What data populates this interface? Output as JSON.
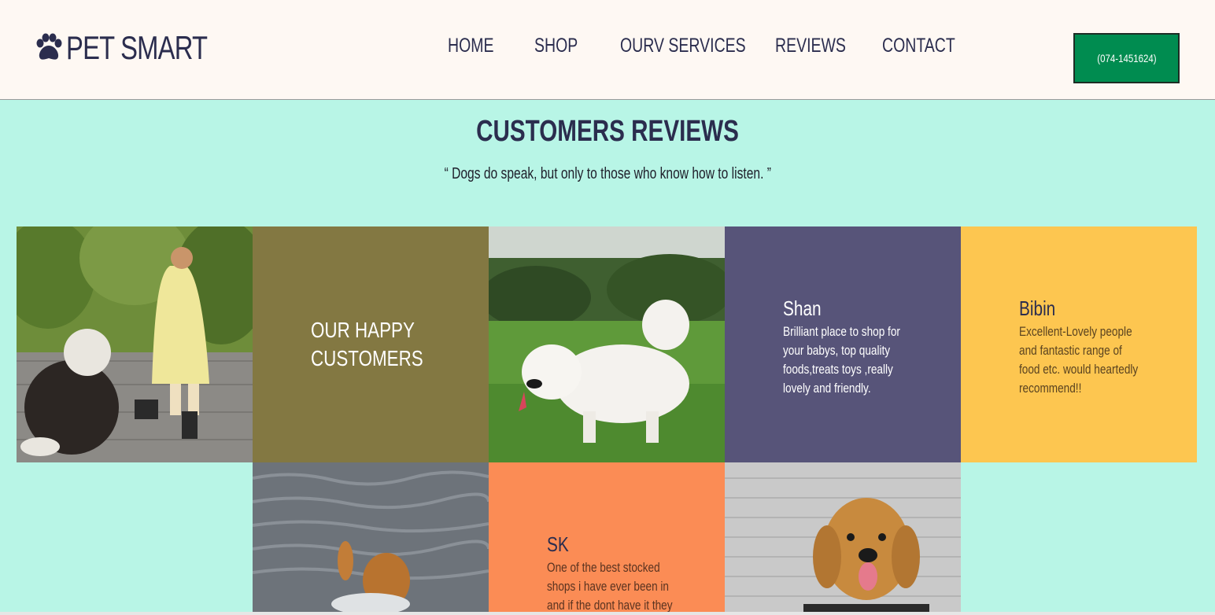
{
  "header": {
    "logo_text": "PET SMART",
    "logo_icon": "paw-icon",
    "nav": {
      "home": "HOME",
      "shop": "SHOP",
      "services": "OURV SERVICES",
      "reviews": "REVIEWS",
      "contact": "CONTACT"
    },
    "phone": "(074-1451624)"
  },
  "reviews_section": {
    "title": "CUSTOMERS REVIEWS",
    "quote": "“ Dogs do speak, but only to those who know how to listen. ”",
    "happy_heading": "OUR HAPPY CUSTOMERS",
    "reviews": [
      {
        "name": "Shan",
        "text": "Brilliant place to shop for your babys, top quality foods,treats toys ,really lovely and friendly."
      },
      {
        "name": "Bibin",
        "text": "Excellent-Lovely people and fantastic range of food etc. would heartedly recommend!!"
      },
      {
        "name": "SK",
        "text": "One of the best stocked shops i have ever been in and if the dont have it they"
      }
    ]
  },
  "colors": {
    "background": "#b8f5e6",
    "header_bg": "#fef8f3",
    "text_primary": "#2b2d4e",
    "phone_button": "#008c50",
    "tile_olive": "#837842",
    "tile_purple": "#575479",
    "tile_yellow": "#fdc650",
    "tile_orange": "#fb8c55"
  }
}
